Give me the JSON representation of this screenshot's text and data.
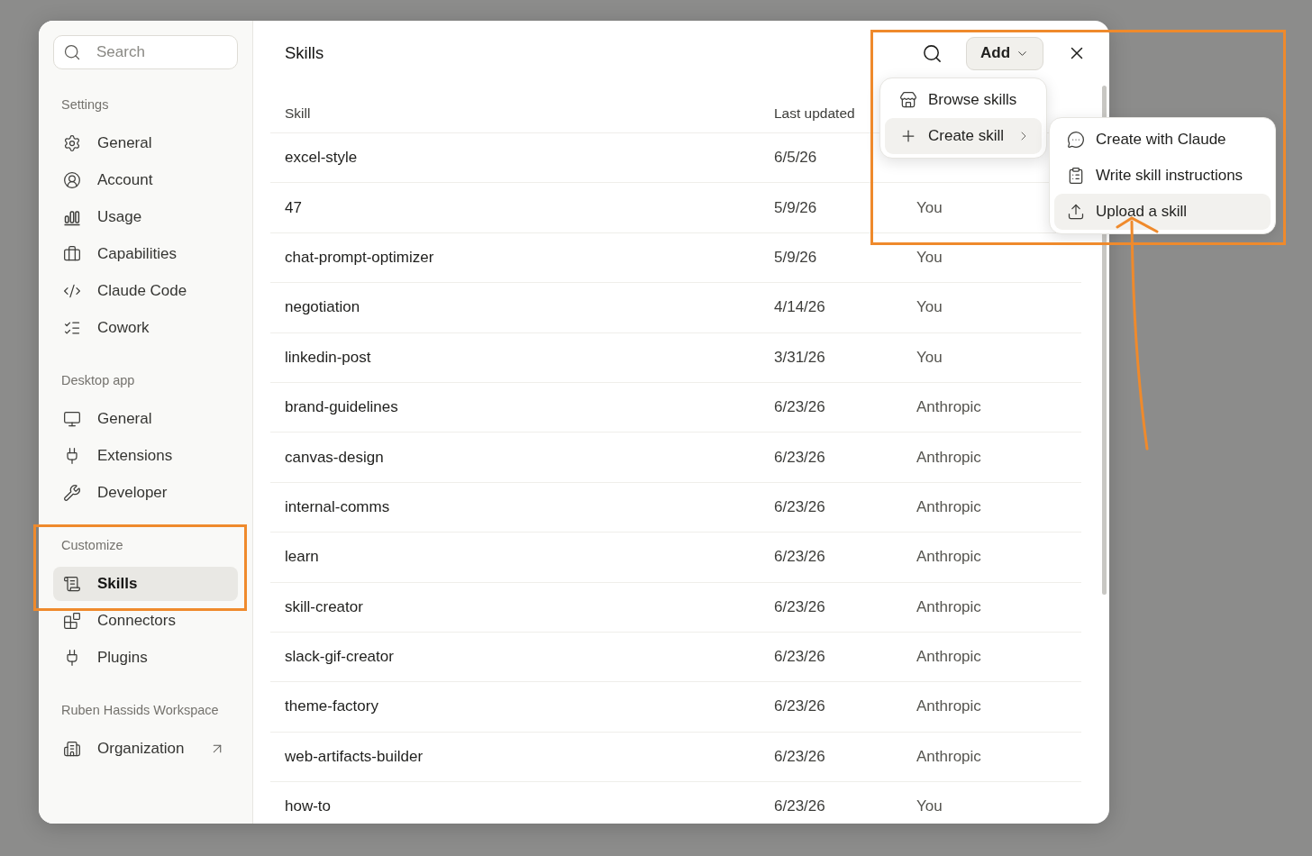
{
  "sidebar": {
    "search": {
      "placeholder": "Search"
    },
    "sections": [
      {
        "label": "Settings",
        "items": [
          {
            "label": "General",
            "selected": false
          },
          {
            "label": "Account",
            "selected": false
          },
          {
            "label": "Usage",
            "selected": false
          },
          {
            "label": "Capabilities",
            "selected": false
          },
          {
            "label": "Claude Code",
            "selected": false
          },
          {
            "label": "Cowork",
            "selected": false
          }
        ]
      },
      {
        "label": "Desktop app",
        "items": [
          {
            "label": "General",
            "selected": false
          },
          {
            "label": "Extensions",
            "selected": false
          },
          {
            "label": "Developer",
            "selected": false
          }
        ]
      },
      {
        "label": "Customize",
        "items": [
          {
            "label": "Skills",
            "selected": true
          },
          {
            "label": "Connectors",
            "selected": false
          },
          {
            "label": "Plugins",
            "selected": false
          }
        ]
      },
      {
        "label": "Ruben Hassids Workspace",
        "items": [
          {
            "label": "Organization",
            "selected": false,
            "external": true
          }
        ]
      }
    ]
  },
  "main": {
    "title": "Skills",
    "add_button": {
      "label": "Add"
    },
    "table": {
      "columns": [
        "Skill",
        "Last updated"
      ],
      "rows": [
        {
          "skill": "excel-style",
          "last_updated": "6/5/26"
        },
        {
          "skill": "47",
          "last_updated": "5/9/26",
          "column_3": "You"
        },
        {
          "skill": "chat-prompt-optimizer",
          "last_updated": "5/9/26",
          "column_3": "You"
        },
        {
          "skill": "negotiation",
          "last_updated": "4/14/26",
          "column_3": "You"
        },
        {
          "skill": "linkedin-post",
          "last_updated": "3/31/26",
          "column_3": "You"
        },
        {
          "skill": "brand-guidelines",
          "last_updated": "6/23/26",
          "column_3": "Anthropic"
        },
        {
          "skill": "canvas-design",
          "last_updated": "6/23/26",
          "column_3": "Anthropic"
        },
        {
          "skill": "internal-comms",
          "last_updated": "6/23/26",
          "column_3": "Anthropic"
        },
        {
          "skill": "learn",
          "last_updated": "6/23/26",
          "column_3": "Anthropic"
        },
        {
          "skill": "skill-creator",
          "last_updated": "6/23/26",
          "column_3": "Anthropic"
        },
        {
          "skill": "slack-gif-creator",
          "last_updated": "6/23/26",
          "column_3": "Anthropic"
        },
        {
          "skill": "theme-factory",
          "last_updated": "6/23/26",
          "column_3": "Anthropic"
        },
        {
          "skill": "web-artifacts-builder",
          "last_updated": "6/23/26",
          "column_3": "Anthropic"
        },
        {
          "skill": "how-to",
          "last_updated": "6/23/26",
          "column_3": "You"
        }
      ]
    }
  },
  "add_menu": {
    "items": [
      {
        "label": "Browse skills",
        "highlighted": false,
        "submenu": false
      },
      {
        "label": "Create skill",
        "highlighted": true,
        "submenu": true
      }
    ]
  },
  "create_submenu": {
    "items": [
      {
        "label": "Create with Claude",
        "highlighted": false
      },
      {
        "label": "Write skill instructions",
        "highlighted": false
      },
      {
        "label": "Upload a skill",
        "highlighted": true
      }
    ]
  }
}
